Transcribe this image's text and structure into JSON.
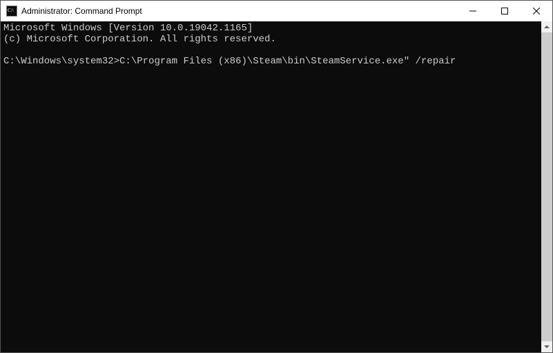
{
  "window": {
    "title": "Administrator: Command Prompt"
  },
  "terminal": {
    "line1": "Microsoft Windows [Version 10.0.19042.1165]",
    "line2": "(c) Microsoft Corporation. All rights reserved.",
    "blank": "",
    "prompt": "C:\\Windows\\system32>",
    "command": "C:\\Program Files (x86)\\Steam\\bin\\SteamService.exe\" /repair"
  }
}
